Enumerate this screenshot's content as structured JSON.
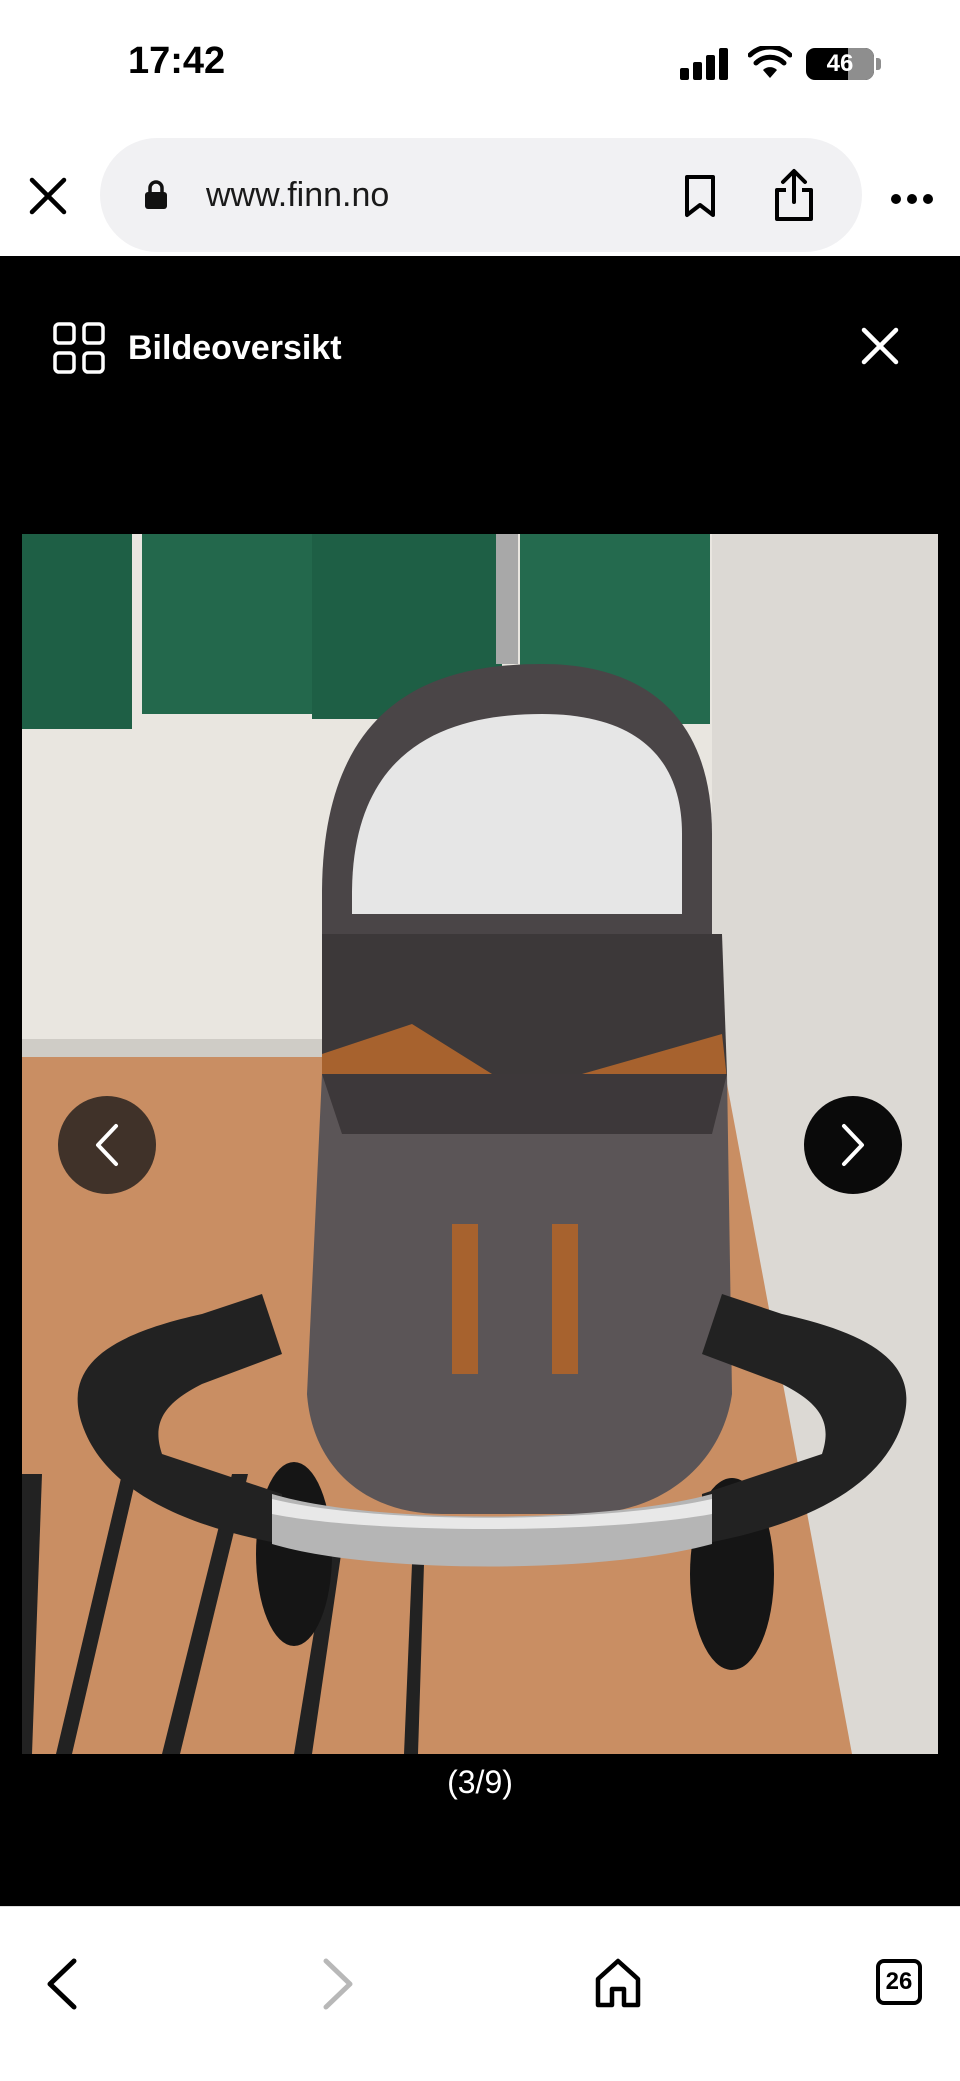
{
  "status_bar": {
    "time": "17:42",
    "battery_level": "46"
  },
  "browser": {
    "url": "www.finn.no",
    "tab_count": "26"
  },
  "viewer": {
    "overview_label": "Bildeoversikt",
    "counter": "(3/9)"
  },
  "icons": {
    "status": [
      "signal-icon",
      "wifi-icon",
      "battery-icon"
    ],
    "url_bar": [
      "close-icon",
      "lock-icon",
      "bookmark-icon",
      "share-icon",
      "more-icon"
    ],
    "viewer": [
      "grid-icon",
      "close-icon",
      "chevron-left-icon",
      "chevron-right-icon"
    ],
    "toolbar": [
      "back-icon",
      "forward-icon",
      "home-icon",
      "tabs-icon"
    ]
  },
  "colors": {
    "viewer_bg": "#000000",
    "chrome_bg": "#ffffff",
    "url_pill": "#f1f1f3"
  }
}
